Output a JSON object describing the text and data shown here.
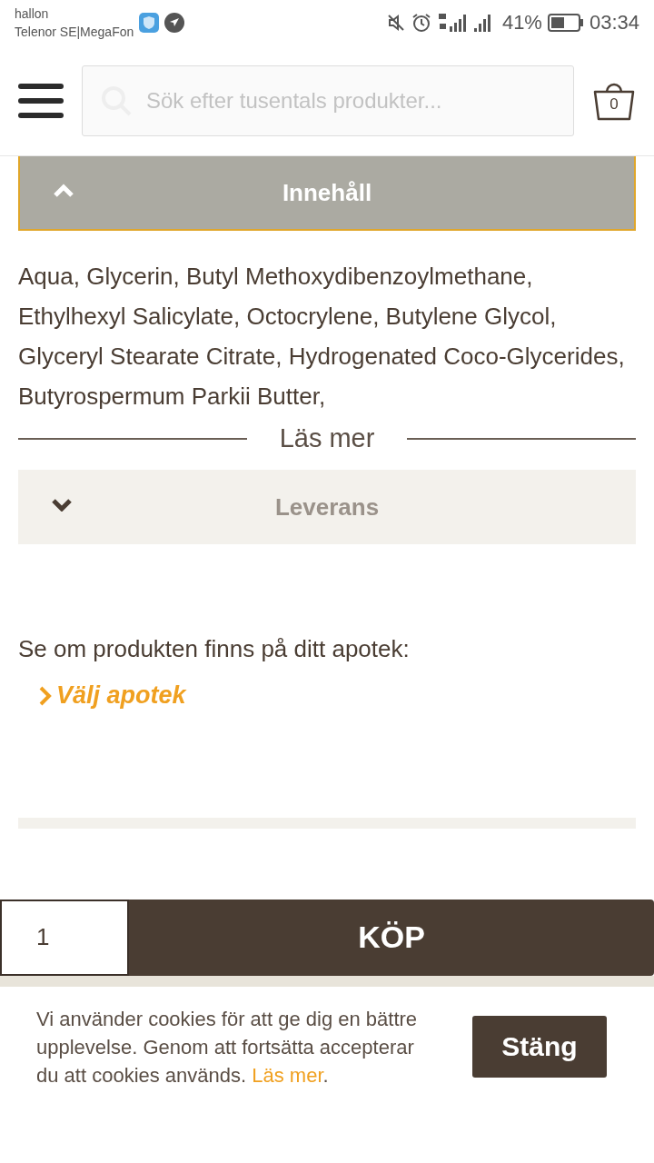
{
  "status_bar": {
    "carrier": "hallon",
    "network": "Telenor SE|MegaFon",
    "battery": "41%",
    "time": "03:34"
  },
  "header": {
    "search": {
      "placeholder": "Sök efter tusentals produkter..."
    },
    "cart_count": "0"
  },
  "sections": [
    {
      "title": "Innehåll",
      "expanded": true,
      "body": "Aqua, Glycerin, Butyl Methoxydibenzoylmethane, Ethylhexyl Salicylate, Octocrylene, Butylene Glycol, Glyceryl Stearate Citrate, Hydrogenated Coco-Glycerides, Butyrospermum Parkii Butter,",
      "more": "Läs mer"
    },
    {
      "title": "Leverans",
      "expanded": false
    }
  ],
  "pharmacy": {
    "text": "Se om produkten finns på ditt apotek:",
    "link": "Välj apotek"
  },
  "buy_bar": {
    "quantity": "1",
    "button": "KÖP"
  },
  "cookie": {
    "text": "Vi använder cookies för att ge dig en bättre upplevelse. Genom att fortsätta accepterar du att cookies används. ",
    "link": "Läs mer",
    "end": ".",
    "button": "Stäng"
  }
}
